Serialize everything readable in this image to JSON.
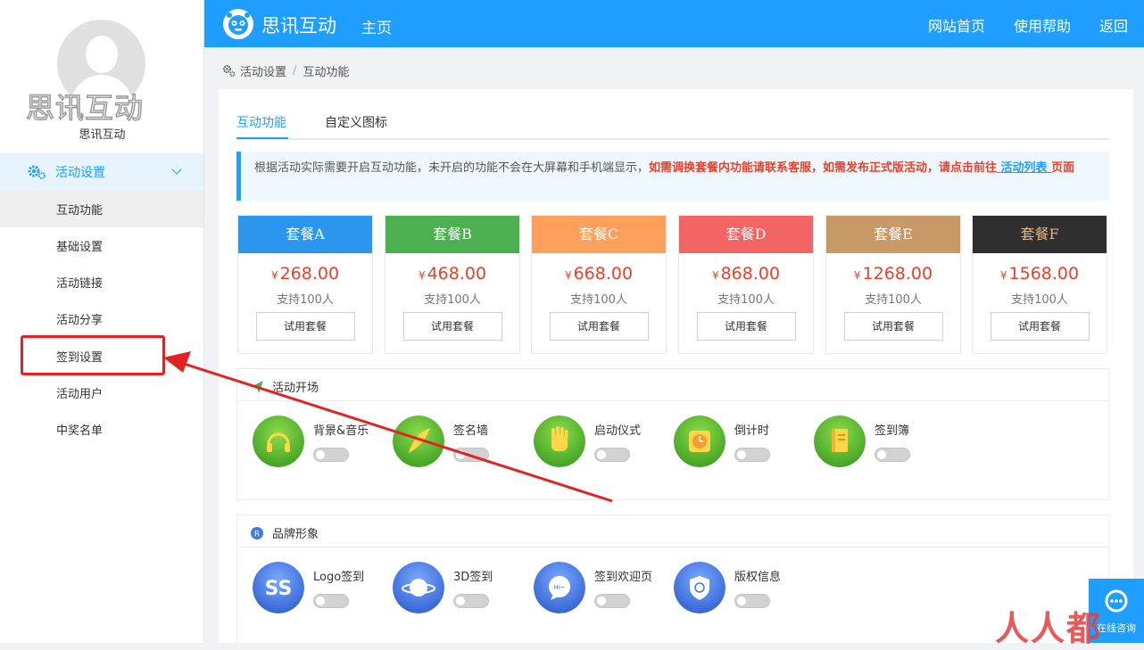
{
  "sidebar": {
    "logo_text": "思讯互动",
    "user_name": "思讯互动",
    "group_label": "活动设置",
    "items": [
      {
        "label": "互动功能"
      },
      {
        "label": "基础设置"
      },
      {
        "label": "活动链接"
      },
      {
        "label": "活动分享"
      },
      {
        "label": "签到设置"
      },
      {
        "label": "活动用户"
      },
      {
        "label": "中奖名单"
      }
    ]
  },
  "topbar": {
    "brand": "思讯互动",
    "home": "主页",
    "links": [
      "网站首页",
      "使用帮助",
      "返回"
    ]
  },
  "breadcrumb": {
    "first": "活动设置",
    "separator": "/",
    "second": "互动功能"
  },
  "tabs": [
    "互动功能",
    "自定义图标"
  ],
  "notice": {
    "text": "根据活动实际需要开启互动功能，未开启的功能不会在大屏幕和手机端显示，",
    "red1": "如需调换套餐内功能请联系客服，如需发布正式版活动，请点击前往",
    "link": " 活动列表 ",
    "red2": "页面"
  },
  "packages": [
    {
      "name": "套餐A",
      "currency": "¥",
      "price": "268.00",
      "support": "支持100人",
      "button": "试用套餐",
      "color": "#2b96ee"
    },
    {
      "name": "套餐B",
      "currency": "¥",
      "price": "468.00",
      "support": "支持100人",
      "button": "试用套餐",
      "color": "#4caf50"
    },
    {
      "name": "套餐C",
      "currency": "¥",
      "price": "668.00",
      "support": "支持100人",
      "button": "试用套餐",
      "color": "#fe9f5b"
    },
    {
      "name": "套餐D",
      "currency": "¥",
      "price": "868.00",
      "support": "支持100人",
      "button": "试用套餐",
      "color": "#f36464"
    },
    {
      "name": "套餐E",
      "currency": "¥",
      "price": "1268.00",
      "support": "支持100人",
      "button": "试用套餐",
      "color": "#c69967"
    },
    {
      "name": "套餐F",
      "currency": "¥",
      "price": "1568.00",
      "support": "支持100人",
      "button": "试用套餐",
      "color": "#2f2f2f"
    }
  ],
  "sections": [
    {
      "title": "活动开场",
      "features": [
        {
          "name": "背景&音乐",
          "icon": "headphones-icon"
        },
        {
          "name": "签名墙",
          "icon": "feather-icon"
        },
        {
          "name": "启动仪式",
          "icon": "hand-icon"
        },
        {
          "name": "倒计时",
          "icon": "alarm-clock-icon"
        },
        {
          "name": "签到簿",
          "icon": "book-icon"
        }
      ]
    },
    {
      "title": "品牌形象",
      "features": [
        {
          "name": "Logo签到",
          "icon": "logo-icon"
        },
        {
          "name": "3D签到",
          "icon": "planet-icon"
        },
        {
          "name": "签到欢迎页",
          "icon": "chat-bubble-icon"
        },
        {
          "name": "版权信息",
          "icon": "shield-icon"
        }
      ]
    }
  ],
  "consult": {
    "label": "在线咨询"
  },
  "watermark": "人人都"
}
